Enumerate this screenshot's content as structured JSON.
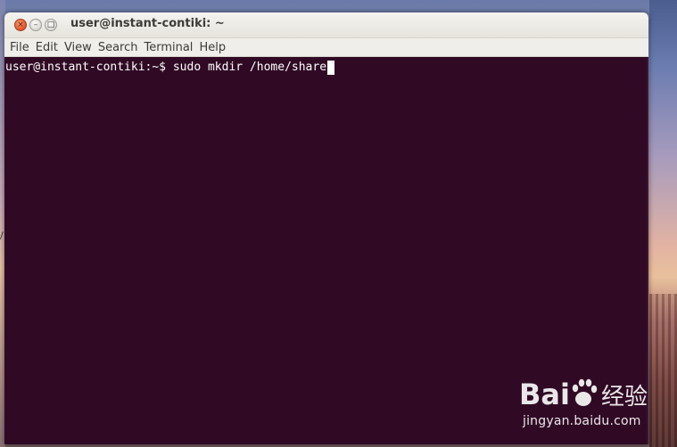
{
  "window": {
    "title": "user@instant-contiki: ~",
    "buttons": {
      "close_glyph": "×",
      "minimize_glyph": "–",
      "maximize_glyph": "□"
    }
  },
  "menu": {
    "items": [
      "File",
      "Edit",
      "View",
      "Search",
      "Terminal",
      "Help"
    ]
  },
  "terminal": {
    "background": "#300a24",
    "foreground": "#ffffff",
    "prompt": "user@instant-contiki:~$ ",
    "command": "sudo mkdir /home/share"
  },
  "desktop": {
    "stray_mark": "/"
  },
  "watermark": {
    "brand": "Baidu经验",
    "url": "jingyan.baidu.com"
  }
}
